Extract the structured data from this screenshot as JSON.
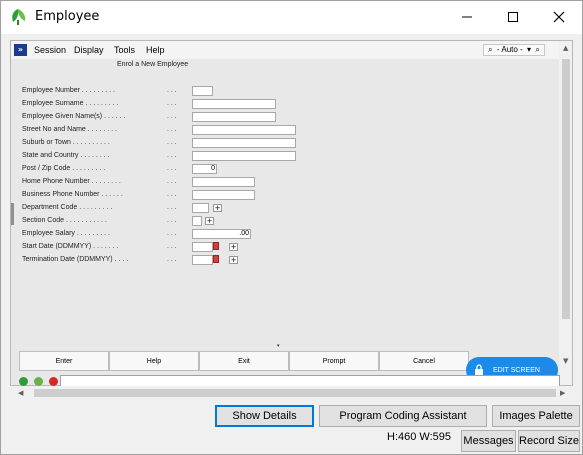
{
  "window": {
    "title": "Employee",
    "icon": "green-leaf-app-icon"
  },
  "menubar": {
    "items": [
      "Session",
      "Display",
      "Tools",
      "Help"
    ],
    "zoom_text": "- Auto -"
  },
  "form": {
    "subtitle": "Enrol a New Employee",
    "fields": [
      {
        "label": "Employee Number . . . . . . . . .",
        "value": ""
      },
      {
        "label": "Employee Surname . . . . . . . . .",
        "value": ""
      },
      {
        "label": "Employee Given Name(s) . . . . . .",
        "value": ""
      },
      {
        "label": "Street No and Name . . . . . . . .",
        "value": ""
      },
      {
        "label": "Suburb or Town . . . . . . . . . .",
        "value": ""
      },
      {
        "label": "State and Country . . . . . . . .",
        "value": ""
      },
      {
        "label": "Post / Zip Code . . . . . . . . .",
        "value": "0"
      },
      {
        "label": "Home Phone Number . . . . . . . .",
        "value": ""
      },
      {
        "label": "Business Phone Number . . . . . .",
        "value": ""
      },
      {
        "label": "Department Code . . . . . . . . .",
        "value": ""
      },
      {
        "label": "Section Code . . . . . . . . . . .",
        "value": ""
      },
      {
        "label": "Employee Salary . . . . . . . . .",
        "value": ".00"
      },
      {
        "label": "Start Date (DDMMYY) . . . . . . .",
        "value": ""
      },
      {
        "label": "Termination Date (DDMMYY) . . . .",
        "value": ""
      }
    ],
    "dots": ". . ."
  },
  "function_keys": [
    "Enter",
    "Help",
    "Exit",
    "Prompt",
    "Cancel"
  ],
  "edit_screen_label": "EDIT SCREEN",
  "bottom_buttons": {
    "show_details": "Show Details",
    "program_coding_assistant": "Program Coding Assistant",
    "images_palette": "Images Palette",
    "messages": "Messages",
    "record_size": "Record Size"
  },
  "size_text": "H:460 W:595",
  "colors": {
    "edit_screen": "#1b8ae8",
    "menu_arrow": "#1a3c8c"
  }
}
